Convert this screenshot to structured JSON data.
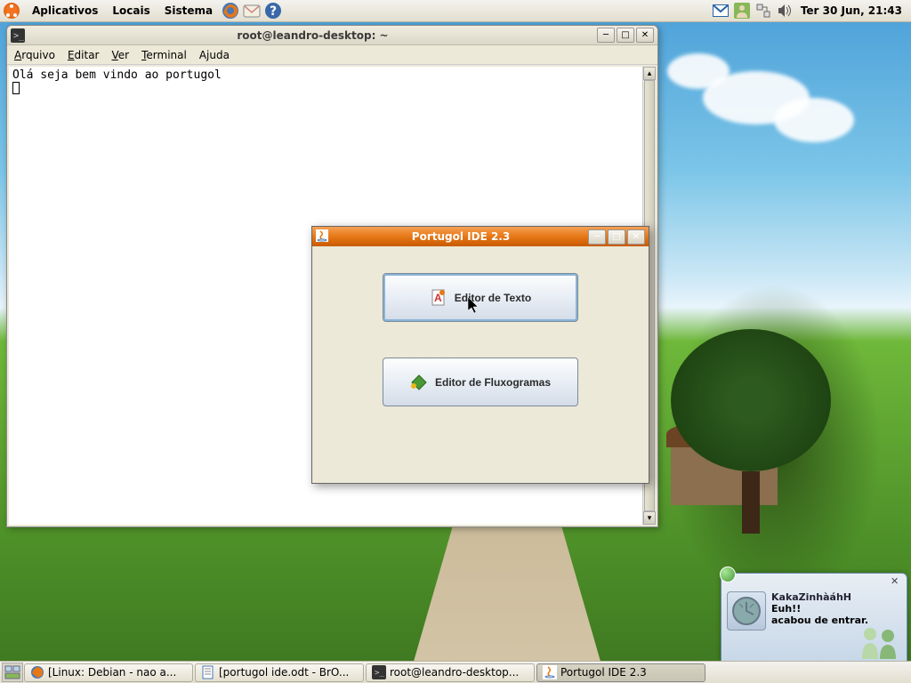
{
  "top_panel": {
    "menus": [
      "Aplicativos",
      "Locais",
      "Sistema"
    ],
    "clock": "Ter 30 Jun, 21:43"
  },
  "terminal": {
    "title": "root@leandro-desktop: ~",
    "menus": [
      {
        "label": "Arquivo",
        "u": 0
      },
      {
        "label": "Editar",
        "u": 0
      },
      {
        "label": "Ver",
        "u": 0
      },
      {
        "label": "Terminal",
        "u": 0
      },
      {
        "label": "Ajuda",
        "u": 1
      }
    ],
    "content": "Olá seja bem vindo ao portugol"
  },
  "java_dialog": {
    "title": "Portugol IDE 2.3",
    "btn1": "Editor de Texto",
    "btn2": "Editor de Fluxogramas"
  },
  "notification": {
    "name": "KakaZinhàáhH",
    "line1": "Euh!!",
    "line2": "acabou de entrar."
  },
  "taskbar": {
    "items": [
      "[Linux: Debian - nao a...",
      "[portugol ide.odt - BrO...",
      "root@leandro-desktop...",
      "Portugol IDE 2.3"
    ]
  }
}
